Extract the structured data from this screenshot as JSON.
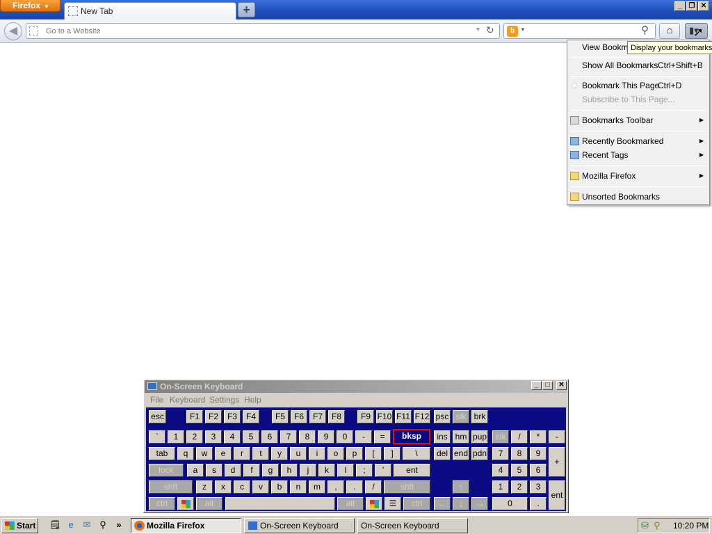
{
  "firefox": {
    "app_button": "Firefox",
    "tab_title": "New Tab",
    "new_tab_symbol": "+",
    "url_placeholder": "Go to a Website",
    "search_value": "",
    "tooltip": "Display your bookmarks"
  },
  "bookmarks_menu": {
    "view_bookmarks": "View Bookma",
    "show_all": {
      "label": "Show All Bookmarks",
      "shortcut": "Ctrl+Shift+B"
    },
    "bookmark_this": {
      "label": "Bookmark This Page",
      "shortcut": "Ctrl+D"
    },
    "subscribe": "Subscribe to This Page...",
    "toolbar": "Bookmarks Toolbar",
    "recently_bookmarked": "Recently Bookmarked",
    "recent_tags": "Recent Tags",
    "mozilla_firefox": "Mozilla Firefox",
    "unsorted": "Unsorted Bookmarks"
  },
  "osk": {
    "title": "On-Screen Keyboard",
    "menu": [
      "File",
      "Keyboard",
      "Settings",
      "Help"
    ],
    "keys": {
      "esc": "esc",
      "fkeys": [
        "F1",
        "F2",
        "F3",
        "F4",
        "F5",
        "F6",
        "F7",
        "F8",
        "F9",
        "F10",
        "F11",
        "F12"
      ],
      "psc": "psc",
      "slk": "slk",
      "brk": "brk",
      "num_row": [
        "`",
        "1",
        "2",
        "3",
        "4",
        "5",
        "6",
        "7",
        "8",
        "9",
        "0",
        "-",
        "="
      ],
      "bksp": "bksp",
      "ins": "ins",
      "hm": "hm",
      "pup": "pup",
      "nlk": "nlk",
      "div": "/",
      "mul": "*",
      "sub": "-",
      "tab": "tab",
      "q_row": [
        "q",
        "w",
        "e",
        "r",
        "t",
        "y",
        "u",
        "i",
        "o",
        "p",
        "[",
        "]",
        "\\"
      ],
      "del": "del",
      "end": "end",
      "pdn": "pdn",
      "n7": "7",
      "n8": "8",
      "n9": "9",
      "add": "+",
      "lock": "lock",
      "a_row": [
        "a",
        "s",
        "d",
        "f",
        "g",
        "h",
        "j",
        "k",
        "l",
        ";",
        "'"
      ],
      "ent": "ent",
      "n4": "4",
      "n5": "5",
      "n6": "6",
      "shft": "shft",
      "z_row": [
        "z",
        "x",
        "c",
        "v",
        "b",
        "n",
        "m",
        ",",
        ".",
        "/"
      ],
      "n1": "1",
      "n2": "2",
      "n3": "3",
      "nument": "ent",
      "ctrl": "ctrl",
      "alt": "alt",
      "n0": "0",
      "ndot": "."
    }
  },
  "taskbar": {
    "start": "Start",
    "quick_launch_more": "»",
    "tasks": [
      "Mozilla Firefox",
      "On-Screen Keyboard",
      "On-Screen Keyboard"
    ],
    "clock": "10:20 PM"
  },
  "colors": {
    "keyboard_bg": "#0a0a82",
    "selected_key_border": "#e01010",
    "firefox_orange": "#e0700f",
    "titlebar_blue": "#1f4fbf"
  },
  "icons": [
    "firefox-menu-icon",
    "back-arrow-icon",
    "reload-icon",
    "bing-icon",
    "magnifier-icon",
    "home-icon",
    "bookmarks-icon",
    "star-icon",
    "folder-icon",
    "windows-logo-icon",
    "keyboard-icon"
  ]
}
